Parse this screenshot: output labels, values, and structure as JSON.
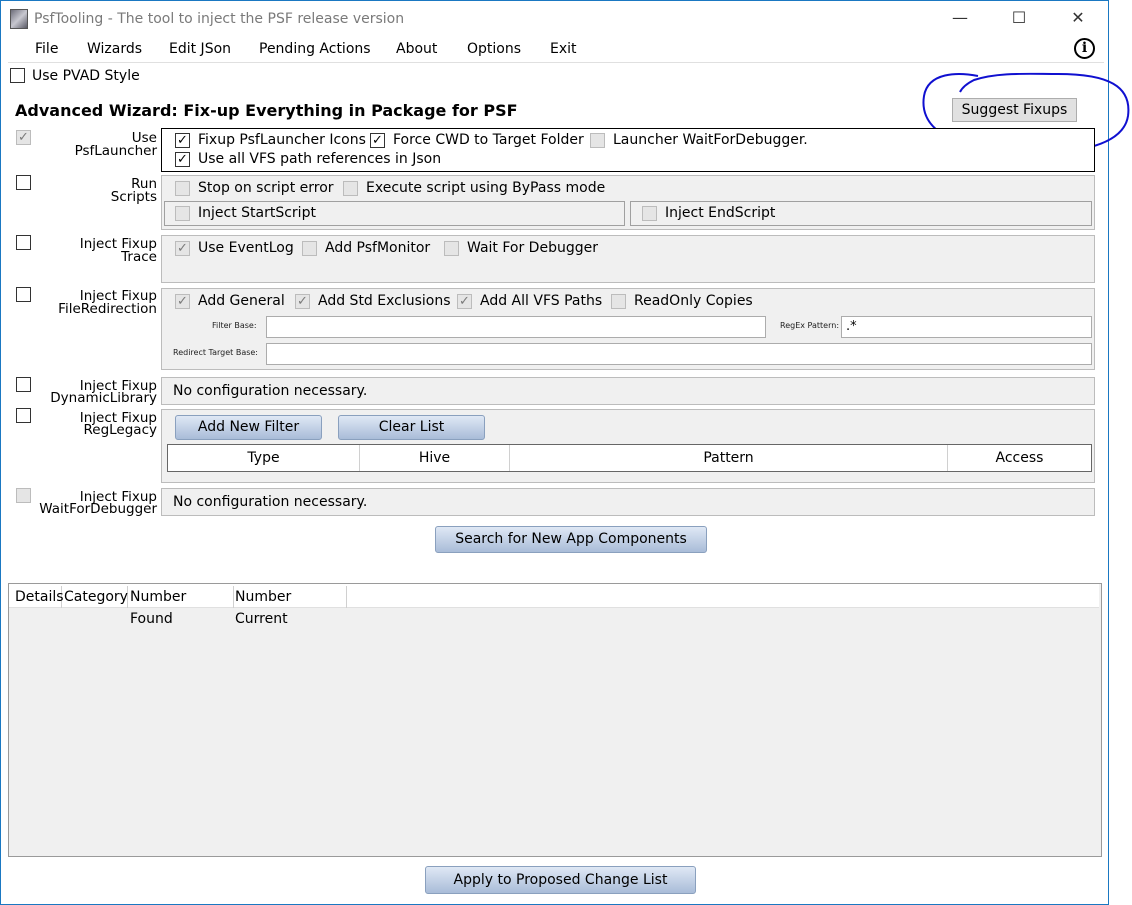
{
  "window": {
    "title": "PsfTooling - The tool to inject the PSF release version",
    "minimize_glyph": "—",
    "maximize_glyph": "☐",
    "close_glyph": "✕"
  },
  "menu": {
    "items": [
      "File",
      "Wizards",
      "Edit JSon",
      "Pending Actions",
      "About",
      "Options",
      "Exit"
    ],
    "info_glyph": "i"
  },
  "pvad": {
    "label": "Use PVAD Style",
    "checked": false
  },
  "wizard_title": "Advanced Wizard: Fix-up Everything in Package for PSF",
  "suggest_button": "Suggest Fixups",
  "sections": {
    "launcher": {
      "label_line1": "Use",
      "label_line2": "PsfLauncher",
      "fixup_icons": "Fixup PsfLauncher Icons",
      "force_cwd": "Force CWD to Target Folder",
      "wait_debugger": "Launcher WaitForDebugger.",
      "use_vfs": "Use all VFS path references in Json"
    },
    "scripts": {
      "label_line1": "Run",
      "label_line2": "Scripts",
      "stop_on_error": "Stop on script error",
      "bypass": "Execute script using ByPass mode",
      "start_script": "Inject StartScript",
      "end_script": "Inject EndScript"
    },
    "trace": {
      "label_line1": "Inject Fixup",
      "label_line2": "Trace",
      "event_log": "Use EventLog",
      "psf_monitor": "Add PsfMonitor",
      "wait_debugger": "Wait For Debugger"
    },
    "file_redirection": {
      "label_line1": "Inject Fixup",
      "label_line2": "FileRedirection",
      "add_general": "Add General",
      "std_exclusions": "Add Std Exclusions",
      "all_vfs": "Add All VFS Paths",
      "readonly": "ReadOnly Copies",
      "filter_base_label": "Filter Base:",
      "regex_label": "RegEx Pattern:",
      "regex_value": ".*",
      "redirect_target_label": "Redirect Target Base:"
    },
    "dynamic_library": {
      "label_line1": "Inject Fixup",
      "label_line2": "DynamicLibrary",
      "note": "No configuration necessary."
    },
    "reg_legacy": {
      "label_line1": "Inject Fixup",
      "label_line2": "RegLegacy",
      "add_filter": "Add New Filter",
      "clear_list": "Clear List",
      "columns": [
        "Type",
        "Hive",
        "Pattern",
        "Access"
      ]
    },
    "wait_for_debugger": {
      "label_line1": "Inject Fixup",
      "label_line2": "WaitForDebugger",
      "note": "No configuration necessary."
    }
  },
  "search_button": "Search for New App Components",
  "results_columns": [
    "Details",
    "Category",
    "Number Found",
    "Number Current"
  ],
  "apply_button": "Apply to Proposed Change List",
  "colors": {
    "accent": "#1a78c2",
    "annotation": "#1010d0",
    "panel_bg": "#f0f0f0"
  }
}
